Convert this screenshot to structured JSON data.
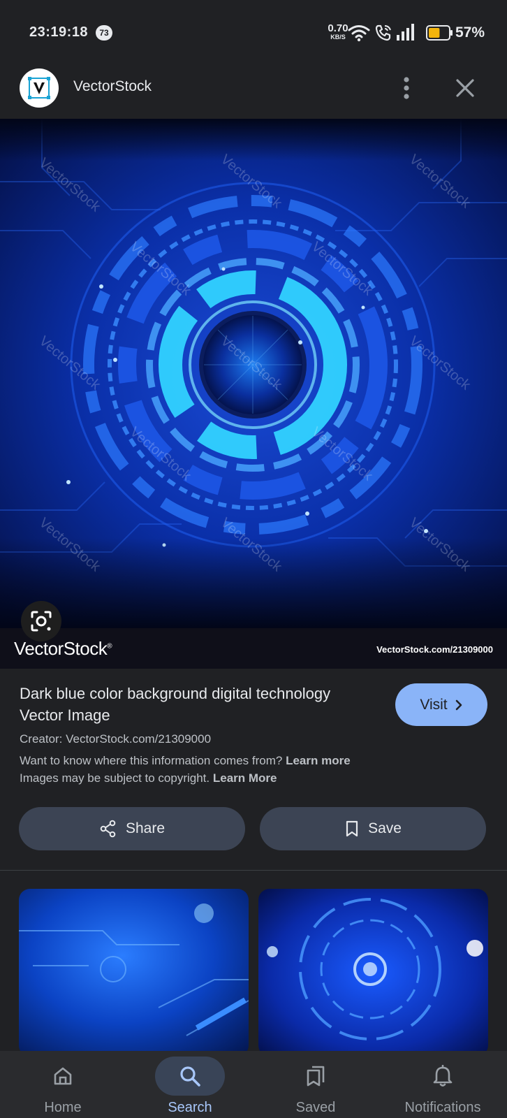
{
  "status_bar": {
    "time": "23:19:18",
    "notification_count": "73",
    "net_speed_value": "0.70",
    "net_speed_unit": "KB/S",
    "battery_percent": "57%",
    "battery_level": 0.57
  },
  "header": {
    "site_name": "VectorStock",
    "more_icon": "more-vert-icon",
    "close_icon": "close-icon"
  },
  "hero": {
    "watermark_brand": "VectorStock",
    "watermark_url": "VectorStock.com/21309000"
  },
  "result": {
    "title": "Dark blue color background digital technology Vector Image",
    "visit_label": "Visit",
    "creator": "Creator: VectorStock.com/21309000",
    "info_question": "Want to know where this information comes from?",
    "info_learn_more": "Learn more",
    "copyright_text": "Images may be subject to copyright.",
    "copyright_learn_more": "Learn More"
  },
  "actions": {
    "share_label": "Share",
    "save_label": "Save"
  },
  "bottom_nav": {
    "items": [
      {
        "label": "Home",
        "icon": "home-icon",
        "active": false
      },
      {
        "label": "Search",
        "icon": "search-icon",
        "active": true
      },
      {
        "label": "Saved",
        "icon": "saved-collections-icon",
        "active": false
      },
      {
        "label": "Notifications",
        "icon": "bell-icon",
        "active": false
      }
    ]
  },
  "colors": {
    "background": "#202124",
    "accent": "#8ab4f8",
    "button_bg": "#3c4454",
    "nav_active_pill": "#394457",
    "nav_active_text": "#a8c7fa"
  }
}
